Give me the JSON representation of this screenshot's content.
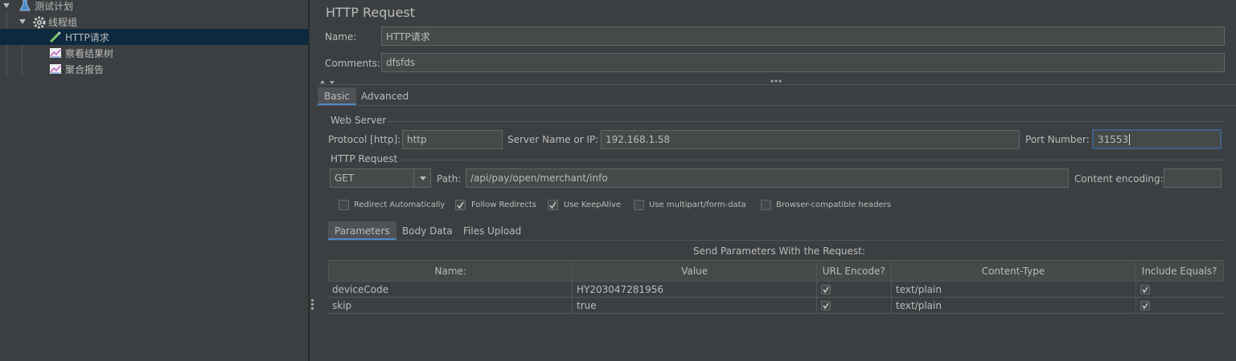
{
  "tree": {
    "items": [
      {
        "label": "测试计划",
        "icon": "flask-icon",
        "expanded": true
      },
      {
        "label": "线程组",
        "icon": "gear-icon",
        "expanded": true
      },
      {
        "label": "HTTP请求",
        "icon": "pipette-icon",
        "selected": true
      },
      {
        "label": "察看结果树",
        "icon": "graph-icon"
      },
      {
        "label": "聚合报告",
        "icon": "graph-icon"
      }
    ]
  },
  "panel": {
    "title": "HTTP Request",
    "name_label": "Name:",
    "name_value": "HTTP请求",
    "comments_label": "Comments:",
    "comments_value": "dfsfds"
  },
  "tabs": {
    "basic": "Basic",
    "advanced": "Advanced"
  },
  "web_server": {
    "section": "Web Server",
    "protocol_label": "Protocol [http]:",
    "protocol_value": "http",
    "server_label": "Server Name or IP:",
    "server_value": "192.168.1.58",
    "port_label": "Port Number:",
    "port_value": "31553"
  },
  "http_request": {
    "section": "HTTP Request",
    "method": "GET",
    "path_label": "Path:",
    "path_value": "/api/pay/open/merchant/info",
    "encoding_label": "Content encoding:",
    "encoding_value": ""
  },
  "options": [
    {
      "label": "Redirect Automatically",
      "checked": false
    },
    {
      "label": "Follow Redirects",
      "checked": true
    },
    {
      "label": "Use KeepAlive",
      "checked": true
    },
    {
      "label": "Use multipart/form-data",
      "checked": false
    },
    {
      "label": "Browser-compatible headers",
      "checked": false
    }
  ],
  "subtabs": {
    "parameters": "Parameters",
    "body": "Body Data",
    "files": "Files Upload"
  },
  "params": {
    "caption": "Send Parameters With the Request:",
    "headers": [
      "Name:",
      "Value",
      "URL Encode?",
      "Content-Type",
      "Include Equals?"
    ],
    "rows": [
      {
        "name": "deviceCode",
        "value": "HY203047281956",
        "url_encode": true,
        "content_type": "text/plain",
        "include_equals": true
      },
      {
        "name": "skip",
        "value": "true",
        "url_encode": true,
        "content_type": "text/plain",
        "include_equals": true
      }
    ]
  },
  "colors": {
    "background": "#3c3f41",
    "selection": "#0d293e",
    "field": "#45494a",
    "accent": "#4a88c7",
    "focus_border": "#3d6185"
  }
}
